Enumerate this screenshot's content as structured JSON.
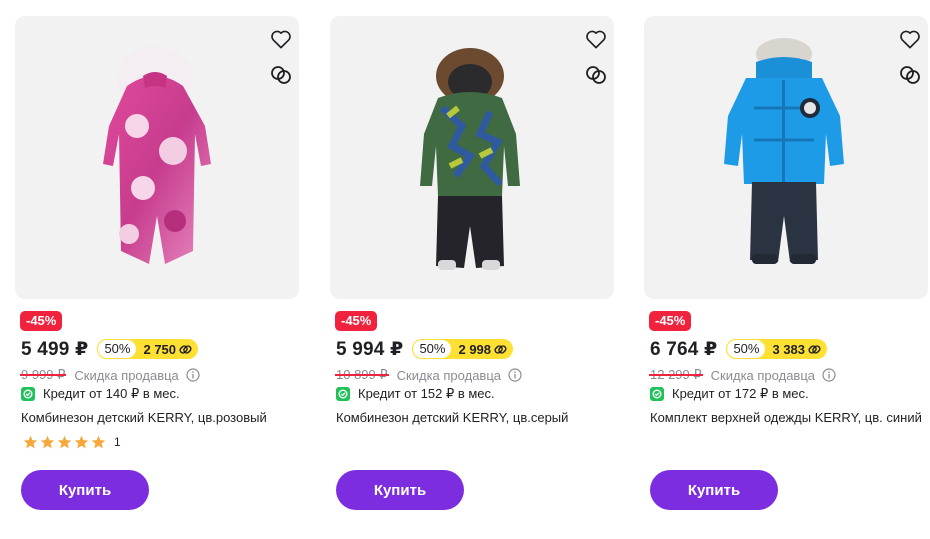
{
  "colors": {
    "accent": "#7d2de0",
    "discount": "#f0223e",
    "promo": "#ffe033",
    "credit": "#21c15a"
  },
  "products": [
    {
      "discount": "-45%",
      "price": "5 499 ₽",
      "promo_percent": "50%",
      "promo_value": "2 750",
      "old_price": "9 999 ₽",
      "seller_discount": "Скидка продавца",
      "credit": "Кредит от 140 ₽ в мес.",
      "title": "Комбинезон детский KERRY, цв.розовый",
      "rating": 5,
      "reviews": "1",
      "buy": "Купить",
      "icons": [
        "heart-icon",
        "compare-icon",
        "info-icon",
        "credit-icon",
        "star-icon"
      ]
    },
    {
      "discount": "-45%",
      "price": "5 994 ₽",
      "promo_percent": "50%",
      "promo_value": "2 998",
      "old_price": "10 899 ₽",
      "seller_discount": "Скидка продавца",
      "credit": "Кредит от 152 ₽ в мес.",
      "title": "Комбинезон детский KERRY, цв.серый",
      "buy": "Купить",
      "icons": [
        "heart-icon",
        "compare-icon",
        "info-icon",
        "credit-icon"
      ]
    },
    {
      "discount": "-45%",
      "price": "6 764 ₽",
      "promo_percent": "50%",
      "promo_value": "3 383",
      "old_price": "12 299 ₽",
      "seller_discount": "Скидка продавца",
      "credit": "Кредит от 172 ₽ в мес.",
      "title": "Комплект верхней одежды KERRY, цв. синий",
      "buy": "Купить",
      "icons": [
        "heart-icon",
        "compare-icon",
        "info-icon",
        "credit-icon"
      ]
    }
  ]
}
